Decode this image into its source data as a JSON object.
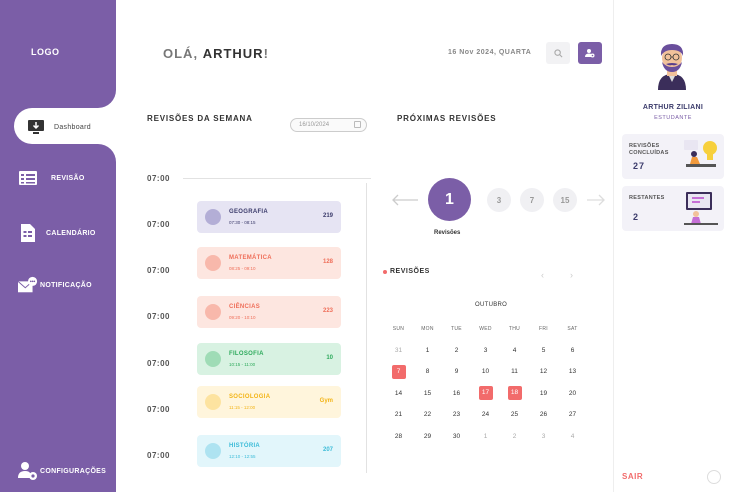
{
  "sidebar": {
    "logo": "LOGO",
    "items": [
      {
        "label": "Dashboard",
        "icon": "monitor-download-icon"
      },
      {
        "label": "REVISÃO",
        "icon": "list-card-icon"
      },
      {
        "label": "CALENDÁRIO",
        "icon": "document-icon"
      },
      {
        "label": "NOTIFICAÇÃO",
        "icon": "mail-chat-icon"
      },
      {
        "label": "CONFIGURAÇÕES",
        "icon": "user-gear-icon"
      }
    ]
  },
  "header": {
    "greeting_prefix": "OLÁ,",
    "greeting_name": "ARTHUR",
    "greeting_suffix": "!",
    "date": "16 Nov 2024, QUARTA"
  },
  "week": {
    "title": "REVISÕES DA SEMANA",
    "date_value": "16/10/2024",
    "times": [
      "07:00",
      "07:00",
      "07:00",
      "07:00",
      "07:00",
      "07:00",
      "07:00"
    ],
    "cards": [
      {
        "name": "GEOGRAFIA",
        "time": "07:30 - 08:15",
        "num": "219",
        "bg": "#e6e4f3",
        "dot": "#b3aed6",
        "color": "#3b3b6b"
      },
      {
        "name": "MATEMÁTICA",
        "time": "08:25 - 09:10",
        "num": "128",
        "bg": "#fde6e0",
        "dot": "#f8b8ab",
        "color": "#ef6f5a"
      },
      {
        "name": "CIÊNCIAS",
        "time": "09:20 - 10:10",
        "num": "223",
        "bg": "#fde6e0",
        "dot": "#f8b8ab",
        "color": "#ef6f5a"
      },
      {
        "name": "FILOSOFIA",
        "time": "10:15 - 11:00",
        "num": "10",
        "bg": "#d8f2e2",
        "dot": "#9fdcb6",
        "color": "#2eaa5c"
      },
      {
        "name": "SOCIOLOGIA",
        "time": "11:15 - 12:00",
        "num": "Gym",
        "bg": "#fff5dc",
        "dot": "#fde3a0",
        "color": "#f3b416"
      },
      {
        "name": "HISTÓRIA",
        "time": "12:10 - 12:55",
        "num": "207",
        "bg": "#e2f6fb",
        "dot": "#aee3f1",
        "color": "#3cbcd8"
      }
    ]
  },
  "upcoming": {
    "title": "PRÓXIMAS REVISÕES",
    "current": "1",
    "caption": "Revisões",
    "others": [
      "3",
      "7",
      "15"
    ]
  },
  "calendar": {
    "label": "REVISÕES",
    "month": "OUTUBRO",
    "weekdays": [
      "SUN",
      "MON",
      "TUE",
      "WED",
      "THU",
      "FRI",
      "SAT"
    ],
    "weeks": [
      [
        {
          "d": "31",
          "m": true
        },
        {
          "d": "1"
        },
        {
          "d": "2"
        },
        {
          "d": "3"
        },
        {
          "d": "4"
        },
        {
          "d": "5"
        },
        {
          "d": "6"
        }
      ],
      [
        {
          "d": "7",
          "h": true
        },
        {
          "d": "8"
        },
        {
          "d": "9"
        },
        {
          "d": "10"
        },
        {
          "d": "11"
        },
        {
          "d": "12"
        },
        {
          "d": "13"
        }
      ],
      [
        {
          "d": "14"
        },
        {
          "d": "15"
        },
        {
          "d": "16"
        },
        {
          "d": "17",
          "h": true
        },
        {
          "d": "18",
          "h": true
        },
        {
          "d": "19"
        },
        {
          "d": "20"
        }
      ],
      [
        {
          "d": "21"
        },
        {
          "d": "22"
        },
        {
          "d": "23"
        },
        {
          "d": "24"
        },
        {
          "d": "25"
        },
        {
          "d": "26"
        },
        {
          "d": "27"
        }
      ],
      [
        {
          "d": "28"
        },
        {
          "d": "29"
        },
        {
          "d": "30"
        },
        {
          "d": "1",
          "m": true
        },
        {
          "d": "2",
          "m": true
        },
        {
          "d": "3",
          "m": true
        },
        {
          "d": "4",
          "m": true
        }
      ]
    ]
  },
  "profile": {
    "name": "ARTHUR ZILIANI",
    "role": "ESTUDANTE",
    "stats": [
      {
        "label": "REVISÕES CONCLUÍDAS",
        "value": "27"
      },
      {
        "label": "RESTANTES",
        "value": "2"
      }
    ],
    "logout": "SAIR"
  },
  "colors": {
    "accent": "#7b5ea7",
    "danger": "#f26b6b"
  }
}
